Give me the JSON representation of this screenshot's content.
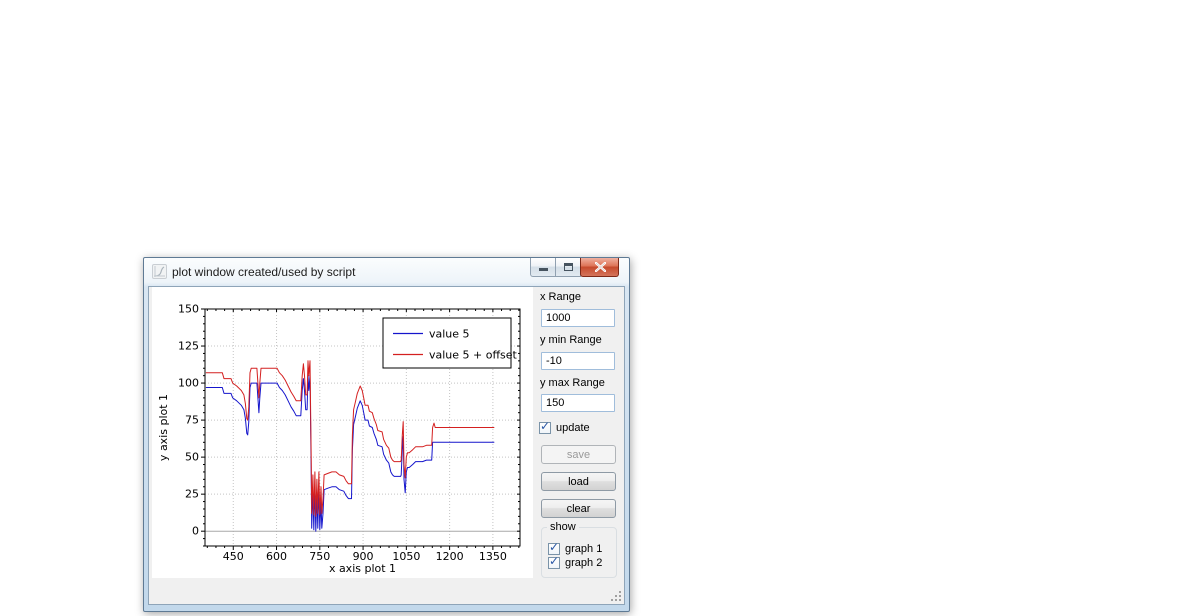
{
  "window": {
    "title": "plot window created/used by script"
  },
  "icons": {
    "check": "✓",
    "minimize": "dash-shape",
    "maximize": "square-shape",
    "close": "x-shape",
    "app": "curve-plot"
  },
  "sidebar": {
    "fields": [
      {
        "label": "x Range",
        "value": "1000"
      },
      {
        "label": "y min Range",
        "value": "-10"
      },
      {
        "label": "y max Range",
        "value": "150"
      }
    ],
    "update": {
      "label": "update",
      "checked": true
    },
    "buttons": {
      "save": {
        "label": "save",
        "enabled": false
      },
      "load": {
        "label": "load",
        "enabled": true
      },
      "clear": {
        "label": "clear",
        "enabled": true
      }
    },
    "show": {
      "label": "show",
      "items": [
        {
          "label": "graph 1",
          "checked": true
        },
        {
          "label": "graph 2",
          "checked": true
        }
      ]
    }
  },
  "chart_data": {
    "type": "line",
    "title": "",
    "xlabel": "x axis plot 1",
    "ylabel": "y axis plot 1",
    "xlim": [
      352,
      1444
    ],
    "ylim": [
      -10,
      150
    ],
    "x_ticks": [
      450,
      600,
      750,
      900,
      1050,
      1200,
      1350
    ],
    "y_ticks": [
      0,
      25,
      50,
      75,
      100,
      125,
      150
    ],
    "x_minor_step": 30,
    "y_minor_step": 5,
    "grid": true,
    "zero_line": true,
    "legend_position": "upper right",
    "colors": {
      "frame": "#000000",
      "grid": "#c4c4c4",
      "zero_line": "#a8a8a8",
      "background": "#ffffff"
    },
    "series": [
      {
        "name": "value 5",
        "color": "#1515cc",
        "points": [
          [
            355,
            97
          ],
          [
            412,
            97
          ],
          [
            418,
            93
          ],
          [
            442,
            93
          ],
          [
            448,
            90
          ],
          [
            462,
            88
          ],
          [
            478,
            85
          ],
          [
            487,
            82
          ],
          [
            492,
            76
          ],
          [
            497,
            66
          ],
          [
            500,
            65
          ],
          [
            504,
            74
          ],
          [
            508,
            97
          ],
          [
            512,
            100
          ],
          [
            532,
            100
          ],
          [
            536,
            88
          ],
          [
            539,
            80
          ],
          [
            542,
            90
          ],
          [
            546,
            100
          ],
          [
            602,
            100
          ],
          [
            610,
            97
          ],
          [
            620,
            95
          ],
          [
            630,
            92
          ],
          [
            640,
            88
          ],
          [
            650,
            84
          ],
          [
            660,
            81
          ],
          [
            668,
            78
          ],
          [
            684,
            78
          ],
          [
            689,
            95
          ],
          [
            693,
            103
          ],
          [
            697,
            95
          ],
          [
            701,
            82
          ],
          [
            706,
            82
          ],
          [
            709,
            105
          ],
          [
            712,
            95
          ],
          [
            716,
            105
          ],
          [
            720,
            40
          ],
          [
            722,
            2
          ],
          [
            726,
            28
          ],
          [
            729,
            1
          ],
          [
            733,
            30
          ],
          [
            736,
            0
          ],
          [
            740,
            25
          ],
          [
            743,
            2
          ],
          [
            747,
            30
          ],
          [
            750,
            1
          ],
          [
            754,
            20
          ],
          [
            757,
            2
          ],
          [
            761,
            12
          ],
          [
            765,
            28
          ],
          [
            778,
            29
          ],
          [
            792,
            30
          ],
          [
            806,
            30
          ],
          [
            818,
            28
          ],
          [
            833,
            27
          ],
          [
            841,
            24
          ],
          [
            849,
            22
          ],
          [
            860,
            22
          ],
          [
            863,
            55
          ],
          [
            867,
            72
          ],
          [
            873,
            77
          ],
          [
            880,
            83
          ],
          [
            890,
            88
          ],
          [
            897,
            85
          ],
          [
            902,
            80
          ],
          [
            907,
            75
          ],
          [
            917,
            75
          ],
          [
            922,
            71
          ],
          [
            932,
            70
          ],
          [
            938,
            66
          ],
          [
            946,
            62
          ],
          [
            951,
            58
          ],
          [
            966,
            57
          ],
          [
            971,
            52
          ],
          [
            981,
            48
          ],
          [
            989,
            46
          ],
          [
            996,
            40
          ],
          [
            1002,
            38
          ],
          [
            1008,
            37
          ],
          [
            1030,
            37
          ],
          [
            1032,
            38
          ],
          [
            1036,
            55
          ],
          [
            1039,
            64
          ],
          [
            1042,
            35
          ],
          [
            1046,
            26
          ],
          [
            1050,
            40
          ],
          [
            1054,
            43
          ],
          [
            1060,
            43
          ],
          [
            1072,
            45
          ],
          [
            1082,
            47
          ],
          [
            1106,
            47
          ],
          [
            1120,
            48
          ],
          [
            1138,
            48
          ],
          [
            1141,
            60
          ],
          [
            1355,
            60
          ]
        ]
      },
      {
        "name": "value 5 + offset",
        "color": "#d42020",
        "points": [
          [
            355,
            107
          ],
          [
            412,
            107
          ],
          [
            418,
            103
          ],
          [
            442,
            103
          ],
          [
            448,
            100
          ],
          [
            462,
            98
          ],
          [
            478,
            95
          ],
          [
            487,
            92
          ],
          [
            492,
            86
          ],
          [
            497,
            76
          ],
          [
            500,
            75
          ],
          [
            504,
            84
          ],
          [
            508,
            107
          ],
          [
            512,
            110
          ],
          [
            532,
            110
          ],
          [
            536,
            98
          ],
          [
            539,
            90
          ],
          [
            542,
            100
          ],
          [
            546,
            110
          ],
          [
            602,
            110
          ],
          [
            610,
            107
          ],
          [
            620,
            105
          ],
          [
            630,
            102
          ],
          [
            640,
            98
          ],
          [
            650,
            94
          ],
          [
            660,
            91
          ],
          [
            668,
            88
          ],
          [
            684,
            88
          ],
          [
            689,
            105
          ],
          [
            693,
            113
          ],
          [
            697,
            105
          ],
          [
            701,
            92
          ],
          [
            706,
            92
          ],
          [
            709,
            115
          ],
          [
            712,
            105
          ],
          [
            716,
            115
          ],
          [
            720,
            50
          ],
          [
            722,
            12
          ],
          [
            726,
            38
          ],
          [
            729,
            11
          ],
          [
            733,
            40
          ],
          [
            736,
            10
          ],
          [
            740,
            35
          ],
          [
            743,
            12
          ],
          [
            747,
            40
          ],
          [
            750,
            11
          ],
          [
            754,
            30
          ],
          [
            757,
            12
          ],
          [
            761,
            22
          ],
          [
            765,
            38
          ],
          [
            778,
            39
          ],
          [
            792,
            40
          ],
          [
            806,
            40
          ],
          [
            818,
            38
          ],
          [
            833,
            37
          ],
          [
            841,
            34
          ],
          [
            849,
            32
          ],
          [
            860,
            32
          ],
          [
            863,
            65
          ],
          [
            867,
            82
          ],
          [
            873,
            87
          ],
          [
            880,
            93
          ],
          [
            890,
            98
          ],
          [
            897,
            95
          ],
          [
            902,
            90
          ],
          [
            907,
            85
          ],
          [
            917,
            85
          ],
          [
            922,
            81
          ],
          [
            932,
            80
          ],
          [
            938,
            76
          ],
          [
            946,
            72
          ],
          [
            951,
            68
          ],
          [
            966,
            67
          ],
          [
            971,
            62
          ],
          [
            981,
            58
          ],
          [
            989,
            56
          ],
          [
            996,
            50
          ],
          [
            1002,
            48
          ],
          [
            1008,
            47
          ],
          [
            1030,
            47
          ],
          [
            1032,
            48
          ],
          [
            1036,
            65
          ],
          [
            1039,
            74
          ],
          [
            1042,
            45
          ],
          [
            1046,
            36
          ],
          [
            1050,
            50
          ],
          [
            1054,
            53
          ],
          [
            1060,
            53
          ],
          [
            1072,
            55
          ],
          [
            1082,
            57
          ],
          [
            1106,
            57
          ],
          [
            1120,
            58
          ],
          [
            1138,
            58
          ],
          [
            1141,
            70
          ],
          [
            1146,
            73
          ],
          [
            1150,
            70
          ],
          [
            1355,
            70
          ]
        ]
      }
    ]
  }
}
